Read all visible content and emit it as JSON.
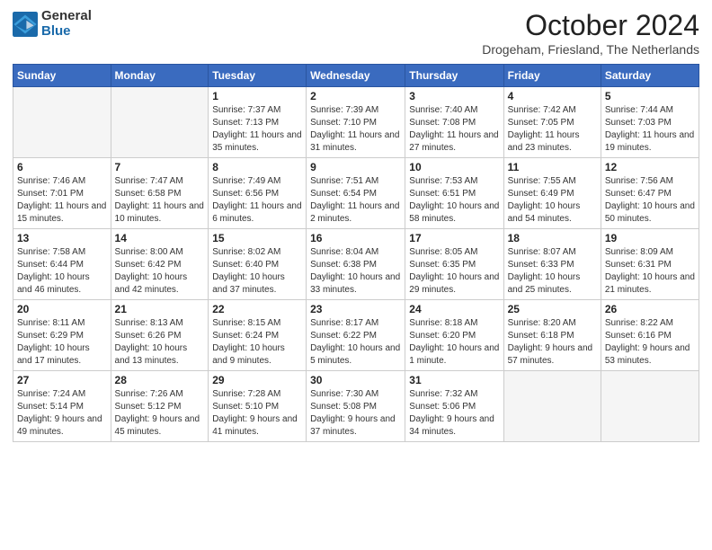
{
  "logo": {
    "general": "General",
    "blue": "Blue"
  },
  "header": {
    "month": "October 2024",
    "location": "Drogeham, Friesland, The Netherlands"
  },
  "weekdays": [
    "Sunday",
    "Monday",
    "Tuesday",
    "Wednesday",
    "Thursday",
    "Friday",
    "Saturday"
  ],
  "weeks": [
    [
      {
        "day": "",
        "info": ""
      },
      {
        "day": "",
        "info": ""
      },
      {
        "day": "1",
        "info": "Sunrise: 7:37 AM\nSunset: 7:13 PM\nDaylight: 11 hours and 35 minutes."
      },
      {
        "day": "2",
        "info": "Sunrise: 7:39 AM\nSunset: 7:10 PM\nDaylight: 11 hours and 31 minutes."
      },
      {
        "day": "3",
        "info": "Sunrise: 7:40 AM\nSunset: 7:08 PM\nDaylight: 11 hours and 27 minutes."
      },
      {
        "day": "4",
        "info": "Sunrise: 7:42 AM\nSunset: 7:05 PM\nDaylight: 11 hours and 23 minutes."
      },
      {
        "day": "5",
        "info": "Sunrise: 7:44 AM\nSunset: 7:03 PM\nDaylight: 11 hours and 19 minutes."
      }
    ],
    [
      {
        "day": "6",
        "info": "Sunrise: 7:46 AM\nSunset: 7:01 PM\nDaylight: 11 hours and 15 minutes."
      },
      {
        "day": "7",
        "info": "Sunrise: 7:47 AM\nSunset: 6:58 PM\nDaylight: 11 hours and 10 minutes."
      },
      {
        "day": "8",
        "info": "Sunrise: 7:49 AM\nSunset: 6:56 PM\nDaylight: 11 hours and 6 minutes."
      },
      {
        "day": "9",
        "info": "Sunrise: 7:51 AM\nSunset: 6:54 PM\nDaylight: 11 hours and 2 minutes."
      },
      {
        "day": "10",
        "info": "Sunrise: 7:53 AM\nSunset: 6:51 PM\nDaylight: 10 hours and 58 minutes."
      },
      {
        "day": "11",
        "info": "Sunrise: 7:55 AM\nSunset: 6:49 PM\nDaylight: 10 hours and 54 minutes."
      },
      {
        "day": "12",
        "info": "Sunrise: 7:56 AM\nSunset: 6:47 PM\nDaylight: 10 hours and 50 minutes."
      }
    ],
    [
      {
        "day": "13",
        "info": "Sunrise: 7:58 AM\nSunset: 6:44 PM\nDaylight: 10 hours and 46 minutes."
      },
      {
        "day": "14",
        "info": "Sunrise: 8:00 AM\nSunset: 6:42 PM\nDaylight: 10 hours and 42 minutes."
      },
      {
        "day": "15",
        "info": "Sunrise: 8:02 AM\nSunset: 6:40 PM\nDaylight: 10 hours and 37 minutes."
      },
      {
        "day": "16",
        "info": "Sunrise: 8:04 AM\nSunset: 6:38 PM\nDaylight: 10 hours and 33 minutes."
      },
      {
        "day": "17",
        "info": "Sunrise: 8:05 AM\nSunset: 6:35 PM\nDaylight: 10 hours and 29 minutes."
      },
      {
        "day": "18",
        "info": "Sunrise: 8:07 AM\nSunset: 6:33 PM\nDaylight: 10 hours and 25 minutes."
      },
      {
        "day": "19",
        "info": "Sunrise: 8:09 AM\nSunset: 6:31 PM\nDaylight: 10 hours and 21 minutes."
      }
    ],
    [
      {
        "day": "20",
        "info": "Sunrise: 8:11 AM\nSunset: 6:29 PM\nDaylight: 10 hours and 17 minutes."
      },
      {
        "day": "21",
        "info": "Sunrise: 8:13 AM\nSunset: 6:26 PM\nDaylight: 10 hours and 13 minutes."
      },
      {
        "day": "22",
        "info": "Sunrise: 8:15 AM\nSunset: 6:24 PM\nDaylight: 10 hours and 9 minutes."
      },
      {
        "day": "23",
        "info": "Sunrise: 8:17 AM\nSunset: 6:22 PM\nDaylight: 10 hours and 5 minutes."
      },
      {
        "day": "24",
        "info": "Sunrise: 8:18 AM\nSunset: 6:20 PM\nDaylight: 10 hours and 1 minute."
      },
      {
        "day": "25",
        "info": "Sunrise: 8:20 AM\nSunset: 6:18 PM\nDaylight: 9 hours and 57 minutes."
      },
      {
        "day": "26",
        "info": "Sunrise: 8:22 AM\nSunset: 6:16 PM\nDaylight: 9 hours and 53 minutes."
      }
    ],
    [
      {
        "day": "27",
        "info": "Sunrise: 7:24 AM\nSunset: 5:14 PM\nDaylight: 9 hours and 49 minutes."
      },
      {
        "day": "28",
        "info": "Sunrise: 7:26 AM\nSunset: 5:12 PM\nDaylight: 9 hours and 45 minutes."
      },
      {
        "day": "29",
        "info": "Sunrise: 7:28 AM\nSunset: 5:10 PM\nDaylight: 9 hours and 41 minutes."
      },
      {
        "day": "30",
        "info": "Sunrise: 7:30 AM\nSunset: 5:08 PM\nDaylight: 9 hours and 37 minutes."
      },
      {
        "day": "31",
        "info": "Sunrise: 7:32 AM\nSunset: 5:06 PM\nDaylight: 9 hours and 34 minutes."
      },
      {
        "day": "",
        "info": ""
      },
      {
        "day": "",
        "info": ""
      }
    ]
  ]
}
